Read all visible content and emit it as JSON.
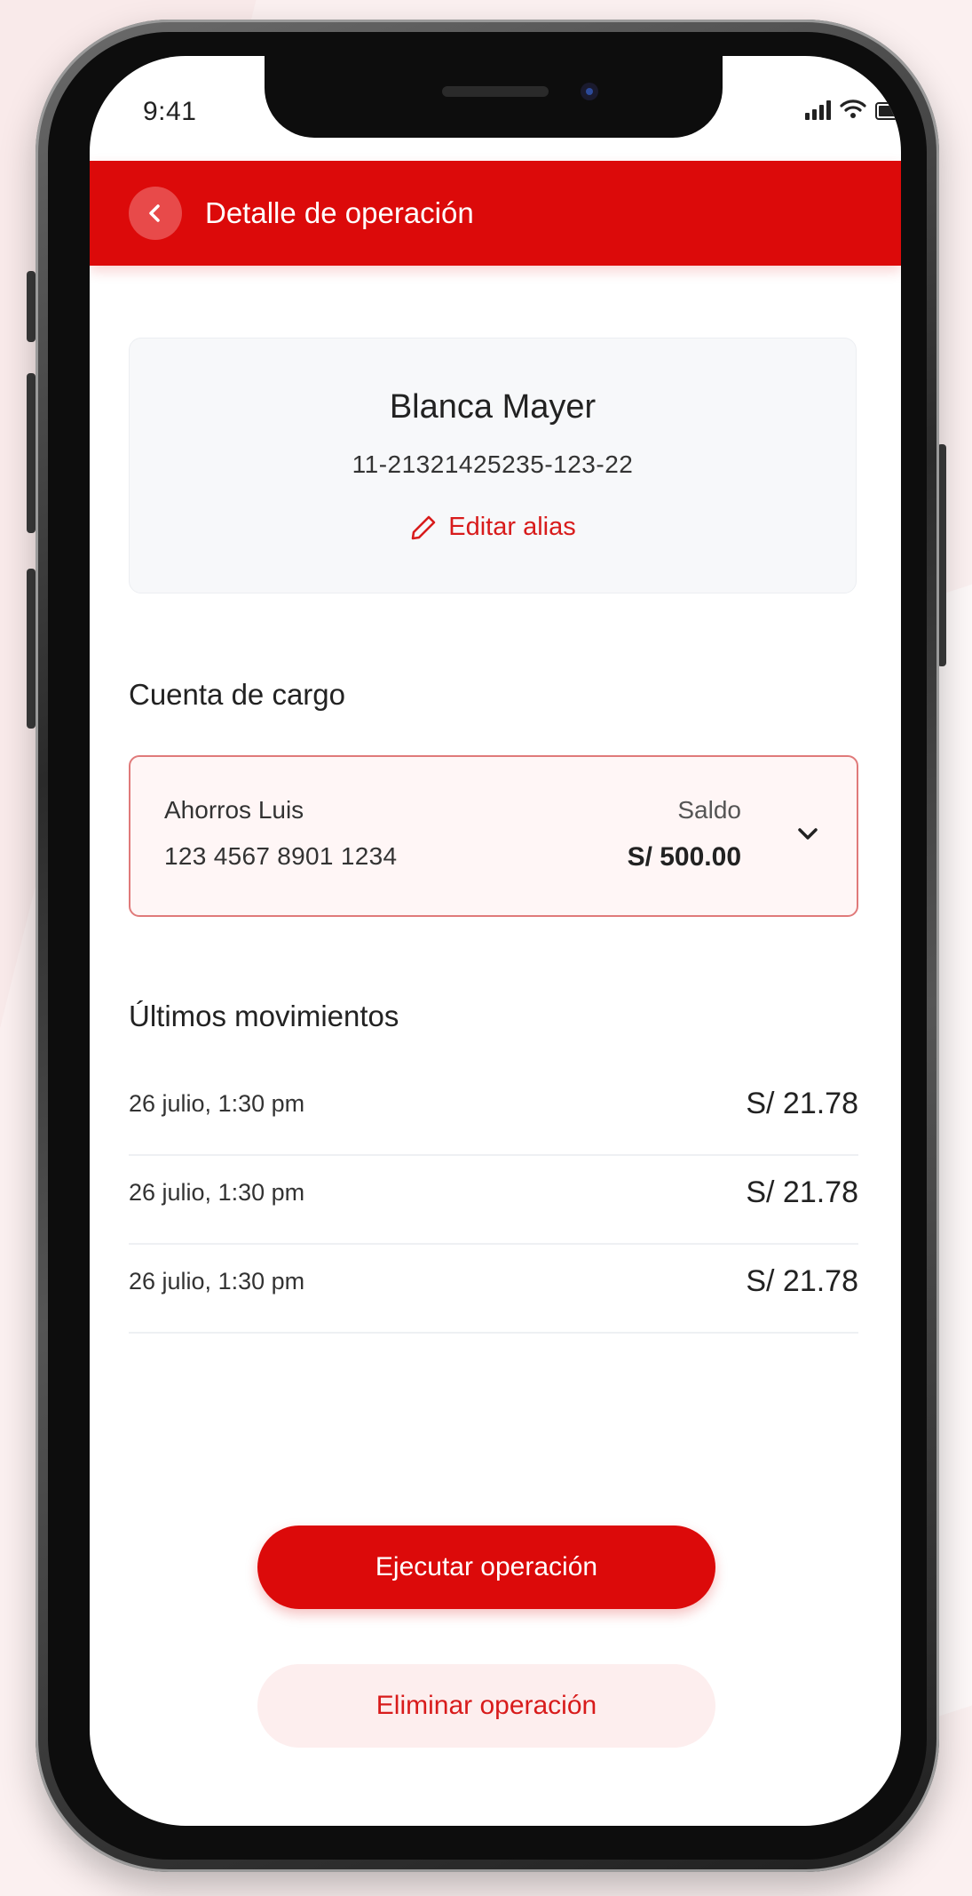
{
  "status_bar": {
    "time": "9:41"
  },
  "header": {
    "title": "Detalle de operación"
  },
  "contact": {
    "name": "Blanca Mayer",
    "account": "11-21321425235-123-22",
    "edit_alias_label": "Editar alias"
  },
  "charge_account": {
    "section_title": "Cuenta de cargo",
    "account_name": "Ahorros Luis",
    "account_number": "123 4567 8901 1234",
    "balance_label": "Saldo",
    "balance_value": "S/ 500.00"
  },
  "movements": {
    "section_title": "Últimos movimientos",
    "items": [
      {
        "date": "26 julio, 1:30 pm",
        "amount": "S/ 21.78"
      },
      {
        "date": "26 julio, 1:30 pm",
        "amount": "S/ 21.78"
      },
      {
        "date": "26 julio, 1:30 pm",
        "amount": "S/ 21.78"
      }
    ]
  },
  "actions": {
    "execute_label": "Ejecutar operación",
    "delete_label": "Eliminar operación"
  },
  "colors": {
    "brand_red": "#dc0a0a",
    "accent_red": "#d81b1b"
  },
  "icons": [
    "back-arrow-icon",
    "pencil-icon",
    "chevron-down-icon",
    "signal-icon",
    "wifi-icon",
    "battery-icon"
  ]
}
